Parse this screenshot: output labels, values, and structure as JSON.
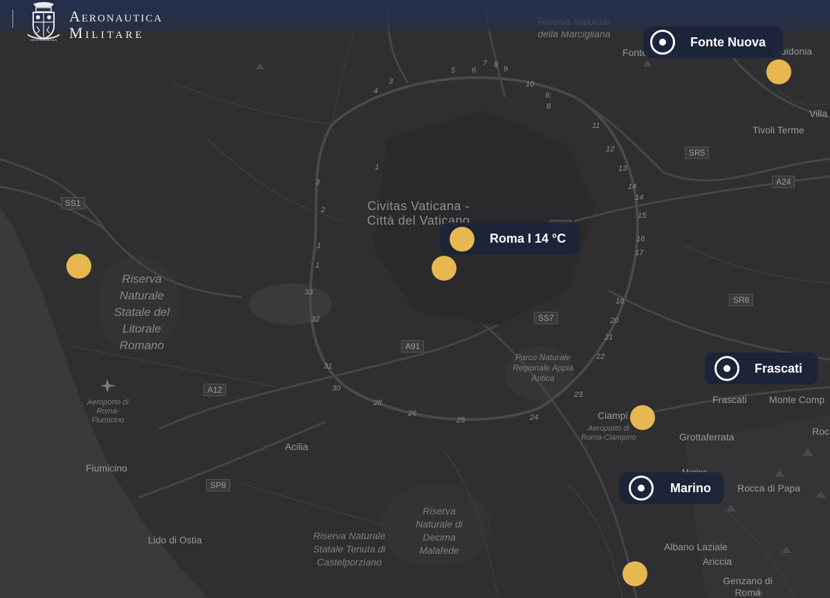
{
  "brand": {
    "logo_line1": "Aeronautica",
    "logo_line2": "Militare",
    "crest_text": "VIRTUTE SIDERUM TENUS"
  },
  "colors": {
    "marker_yellow": "#e7b84f",
    "pill_navy": "#1b243a",
    "map_bg": "#2e2e30",
    "sea": "#3a3a3c"
  },
  "locations": [
    {
      "label": "Fonte Nuova",
      "icon": "target-icon"
    },
    {
      "label": "Roma I 14 °C",
      "icon": "weather-dot"
    },
    {
      "label": "Frascati",
      "icon": "target-icon"
    },
    {
      "label": "Marino",
      "icon": "target-icon"
    }
  ],
  "map_labels": {
    "vatican": "Civitas Vaticana - Città del Vaticano",
    "riserva_litorale": "Riserva Naturale Statale del Litorale Romano",
    "riserva_marcigliana": "Riserva Naturale della Marcigliana",
    "parco_appia": "Parco Naturale Regionale Appia Antica",
    "riserva_decima": "Riserva Naturale di Decima Malafede",
    "riserva_castelporziano": "Riserva Naturale Statale Tenuta di Castelporziano",
    "airport_fiumicino": "Aeroporto di Roma-Fiumicino",
    "airport_ciampino": "Aeroporto di Roma-Ciampino",
    "towns": {
      "fonte_nuova_map": "Fonte Nuova",
      "guidonia": "Guidonia",
      "villa": "Villa",
      "tivoli_terme": "Tivoli Terme",
      "frascati": "Frascati",
      "monte_compatri": "Monte Comp",
      "rocca": "Roc",
      "ciampino": "Ciampi",
      "grottaferrata": "Grottaferrata",
      "marino_map": "Marino",
      "rocca_di_papa": "Rocca di Papa",
      "albano": "Albano Laziale",
      "ariccia": "Ariccia",
      "genzano": "Genzano di Roma",
      "acilia": "Acilia",
      "fiumicino": "Fiumicino",
      "lido_ostia": "Lido di Ostia"
    },
    "roads": {
      "ss1": "SS1",
      "sr5": "SR5",
      "a24_east": "A24",
      "a24_center": "A24",
      "sr6": "SR6",
      "ss7": "SS7",
      "a91": "A91",
      "a12": "A12",
      "sp8": "SP8",
      "top": "SS3"
    },
    "exits": [
      "3",
      "4",
      "5",
      "6",
      "7",
      "8",
      "9",
      "10",
      "9;",
      "8",
      "11",
      "12",
      "13",
      "14",
      "14",
      "15",
      "16",
      "17",
      "18",
      "20",
      "21",
      "22",
      "23",
      "24",
      "25",
      "26",
      "28",
      "30",
      "31",
      "32",
      "33",
      "1",
      "1",
      "2",
      "3",
      "1"
    ]
  }
}
